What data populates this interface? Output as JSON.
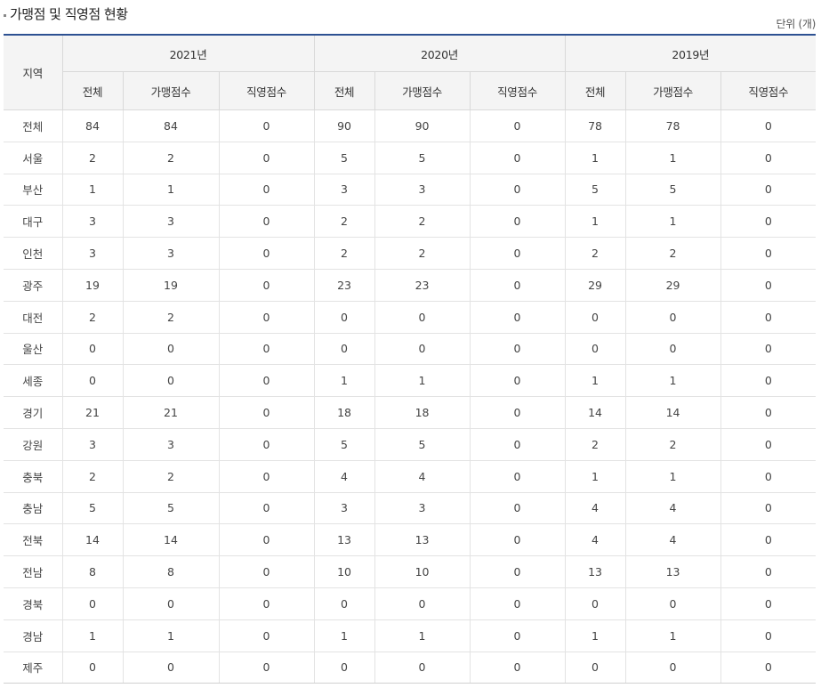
{
  "title": "가맹점 및 직영점 현황",
  "unit": "단위 (개)",
  "headers": {
    "region": "지역",
    "years": [
      "2021년",
      "2020년",
      "2019년"
    ],
    "sub": [
      "전체",
      "가맹점수",
      "직영점수"
    ]
  },
  "rows": [
    [
      "전체",
      "84",
      "84",
      "0",
      "90",
      "90",
      "0",
      "78",
      "78",
      "0"
    ],
    [
      "서울",
      "2",
      "2",
      "0",
      "5",
      "5",
      "0",
      "1",
      "1",
      "0"
    ],
    [
      "부산",
      "1",
      "1",
      "0",
      "3",
      "3",
      "0",
      "5",
      "5",
      "0"
    ],
    [
      "대구",
      "3",
      "3",
      "0",
      "2",
      "2",
      "0",
      "1",
      "1",
      "0"
    ],
    [
      "인천",
      "3",
      "3",
      "0",
      "2",
      "2",
      "0",
      "2",
      "2",
      "0"
    ],
    [
      "광주",
      "19",
      "19",
      "0",
      "23",
      "23",
      "0",
      "29",
      "29",
      "0"
    ],
    [
      "대전",
      "2",
      "2",
      "0",
      "0",
      "0",
      "0",
      "0",
      "0",
      "0"
    ],
    [
      "울산",
      "0",
      "0",
      "0",
      "0",
      "0",
      "0",
      "0",
      "0",
      "0"
    ],
    [
      "세종",
      "0",
      "0",
      "0",
      "1",
      "1",
      "0",
      "1",
      "1",
      "0"
    ],
    [
      "경기",
      "21",
      "21",
      "0",
      "18",
      "18",
      "0",
      "14",
      "14",
      "0"
    ],
    [
      "강원",
      "3",
      "3",
      "0",
      "5",
      "5",
      "0",
      "2",
      "2",
      "0"
    ],
    [
      "충북",
      "2",
      "2",
      "0",
      "4",
      "4",
      "0",
      "1",
      "1",
      "0"
    ],
    [
      "충남",
      "5",
      "5",
      "0",
      "3",
      "3",
      "0",
      "4",
      "4",
      "0"
    ],
    [
      "전북",
      "14",
      "14",
      "0",
      "13",
      "13",
      "0",
      "4",
      "4",
      "0"
    ],
    [
      "전남",
      "8",
      "8",
      "0",
      "10",
      "10",
      "0",
      "13",
      "13",
      "0"
    ],
    [
      "경북",
      "0",
      "0",
      "0",
      "0",
      "0",
      "0",
      "0",
      "0",
      "0"
    ],
    [
      "경남",
      "1",
      "1",
      "0",
      "1",
      "1",
      "0",
      "1",
      "1",
      "0"
    ],
    [
      "제주",
      "0",
      "0",
      "0",
      "0",
      "0",
      "0",
      "0",
      "0",
      "0"
    ]
  ]
}
